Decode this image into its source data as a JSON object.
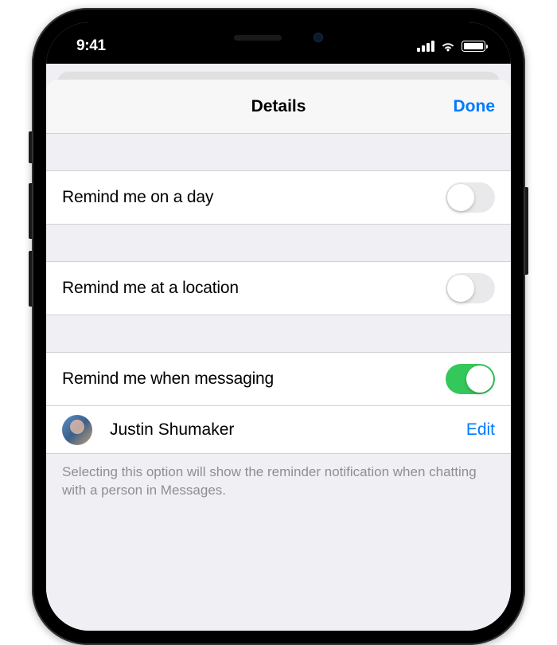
{
  "statusBar": {
    "time": "9:41"
  },
  "nav": {
    "title": "Details",
    "done": "Done"
  },
  "rows": {
    "day": {
      "label": "Remind me on a day",
      "on": false
    },
    "location": {
      "label": "Remind me at a location",
      "on": false
    },
    "messaging": {
      "label": "Remind me when messaging",
      "on": true
    }
  },
  "contact": {
    "name": "Justin Shumaker",
    "edit": "Edit"
  },
  "footer": "Selecting this option will show the reminder notification when chatting with a person in Messages."
}
